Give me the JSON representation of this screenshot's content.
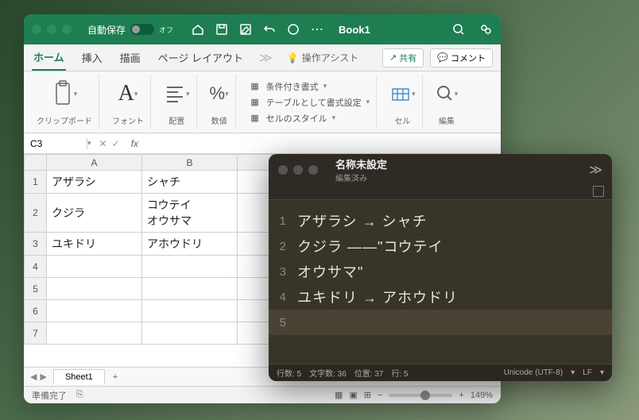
{
  "excel": {
    "autosave_label": "自動保存",
    "autosave_state": "オフ",
    "book_title": "Book1",
    "tabs": [
      "ホーム",
      "挿入",
      "描画",
      "ページ レイアウト"
    ],
    "assist": "操作アシスト",
    "share": "共有",
    "comment": "コメント",
    "ribbon": {
      "clipboard": "クリップボード",
      "font": "フォント",
      "align": "配置",
      "number": "数値",
      "cond": "条件付き書式",
      "tablefmt": "テーブルとして書式設定",
      "cellstyle": "セルのスタイル",
      "cell": "セル",
      "edit": "編集"
    },
    "namebox": "C3",
    "fx": "fx",
    "columns": [
      "A",
      "B"
    ],
    "rows": [
      "1",
      "2",
      "3",
      "4",
      "5",
      "6",
      "7"
    ],
    "cells": {
      "A1": "アザラシ",
      "B1": "シャチ",
      "A2": "クジラ",
      "B2a": "コウテイ",
      "B2b": "オウサマ",
      "A3": "ユキドリ",
      "B3": "アホウドリ"
    },
    "sheet_name": "Sheet1",
    "status_ready": "準備完了",
    "zoom": "149%"
  },
  "editor": {
    "title": "名称未設定",
    "subtitle": "編集済み",
    "lines": [
      "アザラシ → シャチ",
      "クジラ ――\"コウテイ",
      "オウサマ\"",
      "ユキドリ → アホウドリ",
      ""
    ],
    "status": {
      "rows": "行数: 5",
      "chars": "文字数: 36",
      "pos": "位置: 37",
      "line": "行: 5",
      "encoding": "Unicode (UTF-8)",
      "le": "LF"
    }
  }
}
